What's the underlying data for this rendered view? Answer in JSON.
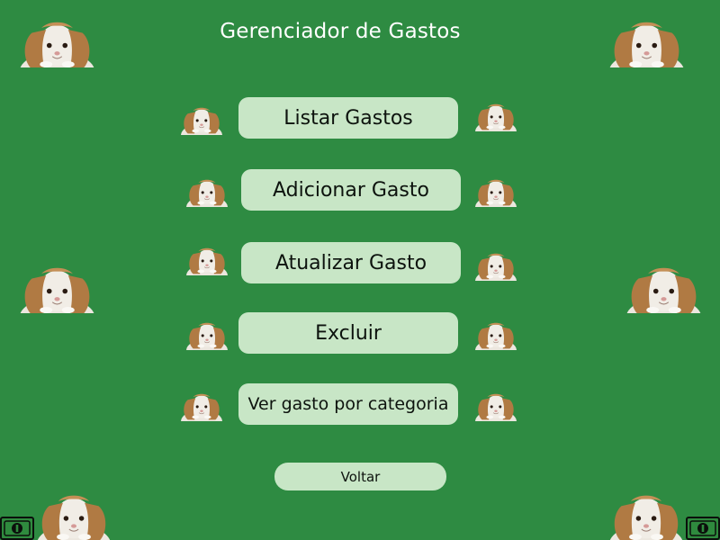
{
  "app": {
    "title": "Gerenciador de Gastos"
  },
  "menu": {
    "list_label": "Listar Gastos",
    "add_label": "Adicionar Gasto",
    "update_label": "Atualizar Gasto",
    "delete_label": "Excluir",
    "by_category_label": "Ver gasto por categoria"
  },
  "footer": {
    "back_label": "Voltar"
  },
  "colors": {
    "background": "#2e8b42",
    "button_bg": "#c8e6c6",
    "button_text": "#0d130e",
    "title_text": "#ffffff"
  },
  "icons": {
    "decoration": "bunny-icon",
    "money": "money-bill-icon"
  }
}
